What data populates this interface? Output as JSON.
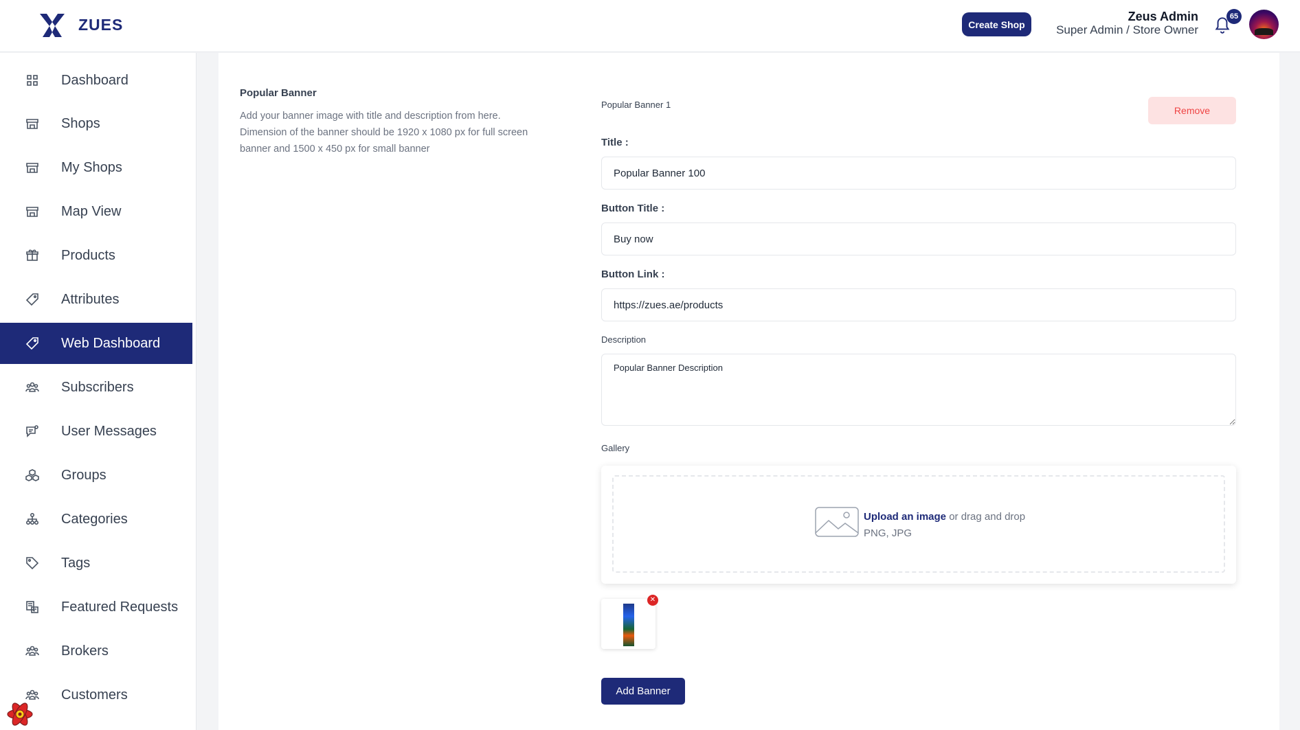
{
  "header": {
    "brand": "ZUES",
    "create_shop_label": "Create Shop",
    "user_name": "Zeus Admin",
    "user_role": "Super Admin / Store Owner",
    "notification_count": "65"
  },
  "sidebar": {
    "items": [
      {
        "label": "Dashboard",
        "icon": "grid-icon"
      },
      {
        "label": "Shops",
        "icon": "store-icon"
      },
      {
        "label": "My Shops",
        "icon": "store-icon"
      },
      {
        "label": "Map View",
        "icon": "store-icon"
      },
      {
        "label": "Products",
        "icon": "gift-icon"
      },
      {
        "label": "Attributes",
        "icon": "tag-icon"
      },
      {
        "label": "Web Dashboard",
        "icon": "tag-icon",
        "active": true
      },
      {
        "label": "Subscribers",
        "icon": "users-icon"
      },
      {
        "label": "User Messages",
        "icon": "message-icon"
      },
      {
        "label": "Groups",
        "icon": "cubes-icon"
      },
      {
        "label": "Categories",
        "icon": "hierarchy-icon"
      },
      {
        "label": "Tags",
        "icon": "label-icon"
      },
      {
        "label": "Featured Requests",
        "icon": "featured-icon"
      },
      {
        "label": "Brokers",
        "icon": "users-icon"
      },
      {
        "label": "Customers",
        "icon": "users-icon"
      }
    ]
  },
  "section": {
    "title": "Popular Banner",
    "description": "Add your banner image with title and description from here. Dimension of the banner should be 1920 x 1080 px for full screen banner and 1500 x 450 px for small banner"
  },
  "form": {
    "heading": "Popular Banner 1",
    "remove_label": "Remove",
    "title_label": "Title :",
    "title_value": "Popular Banner 100",
    "button_title_label": "Button Title :",
    "button_title_value": "Buy now",
    "button_link_label": "Button Link :",
    "button_link_value": "https://zues.ae/products",
    "description_label": "Description",
    "description_value": "Popular Banner Description",
    "gallery_label": "Gallery",
    "upload_link": "Upload an image",
    "upload_rest": " or drag and drop",
    "upload_formats": "PNG, JPG",
    "add_banner_label": "Add Banner"
  },
  "colors": {
    "primary": "#1e2a78",
    "danger_bg": "#fde2e2",
    "danger_text": "#ef4444"
  }
}
